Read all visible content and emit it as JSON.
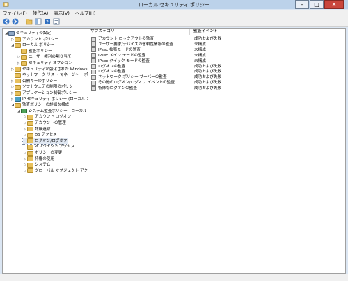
{
  "window": {
    "title": "ローカル セキュリティ ポリシー"
  },
  "menubar": [
    "ファイル(F)",
    "操作(A)",
    "表示(V)",
    "ヘルプ(H)"
  ],
  "toolbar": {
    "icons": [
      "back-arrow-icon",
      "forward-arrow-icon",
      "up-folder-icon",
      "show-hide-tree-icon",
      "help-icon",
      "properties-icon"
    ]
  },
  "tree": [
    {
      "label": "セキュリティの設定",
      "level": 0,
      "expander": "◢",
      "icon": "computer"
    },
    {
      "label": "アカウント ポリシー",
      "level": 1,
      "expander": "▷",
      "icon": "folder"
    },
    {
      "label": "ローカル ポリシー",
      "level": 1,
      "expander": "◢",
      "icon": "folder"
    },
    {
      "label": "監査ポリシー",
      "level": 2,
      "expander": "",
      "icon": "folder"
    },
    {
      "label": "ユーザー権利の割り当て",
      "level": 2,
      "expander": "▷",
      "icon": "folder"
    },
    {
      "label": "セキュリティ オプション",
      "level": 2,
      "expander": "▷",
      "icon": "folder"
    },
    {
      "label": "セキュリティが強化された Windows ファイ",
      "level": 1,
      "expander": "▷",
      "icon": "folder"
    },
    {
      "label": "ネットワーク リスト マネージャー ポリシー",
      "level": 1,
      "expander": "",
      "icon": "folder"
    },
    {
      "label": "公開キーのポリシー",
      "level": 1,
      "expander": "▷",
      "icon": "folder"
    },
    {
      "label": "ソフトウェアの制限のポリシー",
      "level": 1,
      "expander": "▷",
      "icon": "folder"
    },
    {
      "label": "アプリケーション制御ポリシー",
      "level": 1,
      "expander": "▷",
      "icon": "folder"
    },
    {
      "label": "IP セキュリティ ポリシー (ローカル コンピュ",
      "level": 1,
      "expander": "▷",
      "icon": "net"
    },
    {
      "label": "監査ポリシーの詳細な構成",
      "level": 1,
      "expander": "◢",
      "icon": "folder"
    },
    {
      "label": "システム監査ポリシー - ローカル グル",
      "level": 2,
      "expander": "◢",
      "icon": "green"
    },
    {
      "label": "アカウント ログオン",
      "level": 3,
      "expander": "▷",
      "icon": "folder"
    },
    {
      "label": "アカウントの管理",
      "level": 3,
      "expander": "▷",
      "icon": "folder"
    },
    {
      "label": "詳細追跡",
      "level": 3,
      "expander": "▷",
      "icon": "folder"
    },
    {
      "label": "DS アクセス",
      "level": 3,
      "expander": "▷",
      "icon": "folder"
    },
    {
      "label": "ログオン/ログオフ",
      "level": 3,
      "expander": "",
      "icon": "folder",
      "selected": true
    },
    {
      "label": "オブジェクト アクセス",
      "level": 3,
      "expander": "",
      "icon": "folder"
    },
    {
      "label": "ポリシーの変更",
      "level": 3,
      "expander": "▷",
      "icon": "folder"
    },
    {
      "label": "特権の使用",
      "level": 3,
      "expander": "▷",
      "icon": "folder"
    },
    {
      "label": "システム",
      "level": 3,
      "expander": "▷",
      "icon": "folder"
    },
    {
      "label": "グローバル オブジェクト アクセスの監",
      "level": 3,
      "expander": "▷",
      "icon": "folder"
    }
  ],
  "list": {
    "columns": [
      "サブカテゴリ",
      "監査イベント"
    ],
    "rows": [
      {
        "subcategory": "アカウント ロックアウトの監査",
        "event": "成功および失敗"
      },
      {
        "subcategory": "ユーザー要求/デバイスの信頼性情報の監査",
        "event": "未構成"
      },
      {
        "subcategory": "IPsec 拡張モードの監査",
        "event": "未構成"
      },
      {
        "subcategory": "IPsec メイン モードの監査",
        "event": "未構成"
      },
      {
        "subcategory": "IPsec クイック モードの監査",
        "event": "未構成"
      },
      {
        "subcategory": "ログオフの監査",
        "event": "成功および失敗"
      },
      {
        "subcategory": "ログオンの監査",
        "event": "成功および失敗"
      },
      {
        "subcategory": "ネットワーク ポリシー サーバーの監査",
        "event": "成功および失敗"
      },
      {
        "subcategory": "その他のログオン/ログオフ イベントの監査",
        "event": "成功および失敗"
      },
      {
        "subcategory": "特殊なログオンの監査",
        "event": "成功および失敗"
      }
    ]
  }
}
